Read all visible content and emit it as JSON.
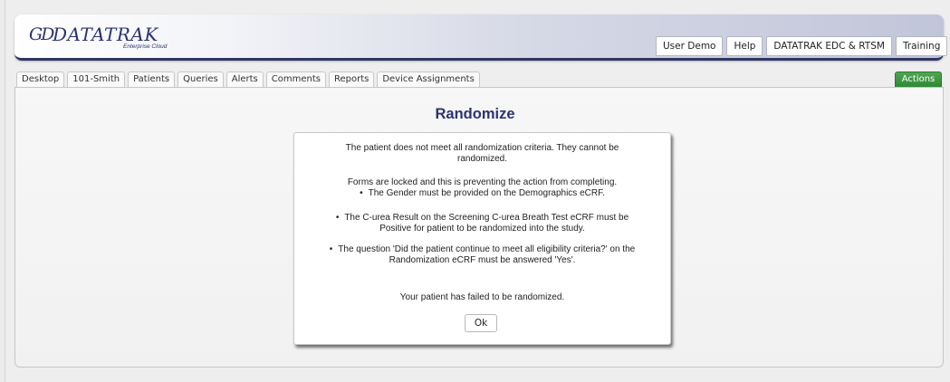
{
  "header": {
    "logo_mark": "GD",
    "logo_text": "DATATRAK",
    "logo_subtitle": "Enterprise Cloud",
    "nav": [
      "User Demo",
      "Help",
      "DATATRAK EDC & RTSM",
      "Training"
    ]
  },
  "tabs": [
    "Desktop",
    "101-Smith",
    "Patients",
    "Queries",
    "Alerts",
    "Comments",
    "Reports",
    "Device Assignments"
  ],
  "actions_label": "Actions",
  "page_title": "Randomize",
  "dialog": {
    "line1": "The patient does not meet all randomization criteria. They cannot be",
    "line2": "randomized.",
    "line3": "Forms are locked and this is preventing the action from completing.",
    "line4": "The Gender must be provided on the Demographics eCRF.",
    "line5": "The C-urea Result on the Screening C-urea Breath Test eCRF must be",
    "line6": "Positive for patient to be randomized into the study.",
    "line7": "The question 'Did the patient continue to meet all eligibility criteria?' on the",
    "line8": "Randomization eCRF must be answered 'Yes'.",
    "line9": "Your patient has failed to be randomized.",
    "ok_label": "Ok"
  },
  "colors": {
    "brand_navy": "#2b3470",
    "actions_green": "#3a9a3e"
  }
}
